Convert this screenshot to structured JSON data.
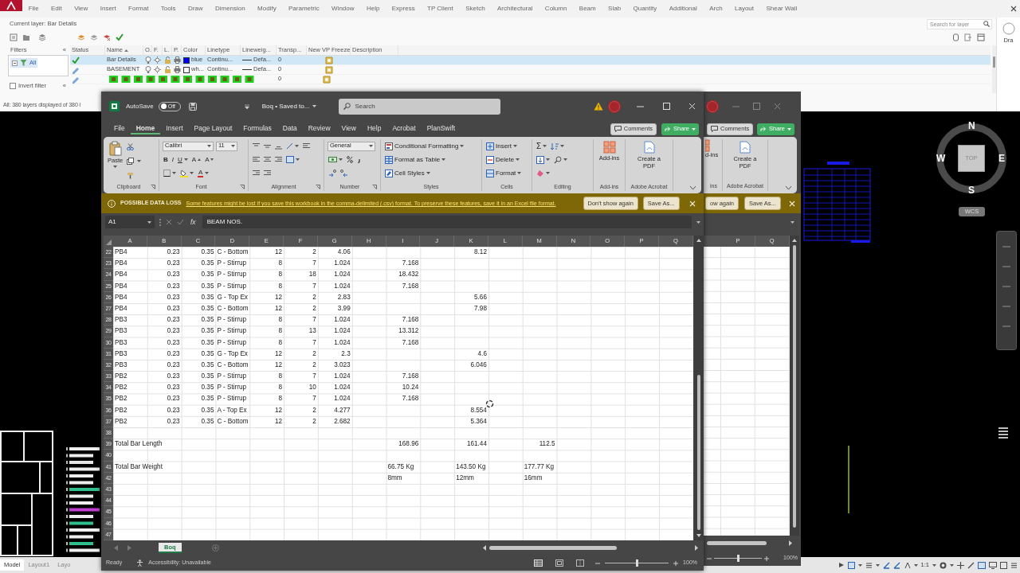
{
  "autocad": {
    "menu": [
      "File",
      "Edit",
      "View",
      "Insert",
      "Format",
      "Tools",
      "Draw",
      "Dimension",
      "Modify",
      "Parametric",
      "Window",
      "Help",
      "Express",
      "TP Client",
      "Sketch",
      "Architectural",
      "Column",
      "Beam",
      "Slab",
      "Quantity",
      "Additional",
      "Arch",
      "Layout",
      "Shear Wall"
    ],
    "layer_manager": {
      "current_layer": "Current layer: Bar Details",
      "search": {
        "placeholder": "Search for layer"
      },
      "filters": {
        "heading": "Filters",
        "collapse": "«",
        "items": [
          {
            "label": "All",
            "selected": true
          }
        ],
        "invert_filter": {
          "label": "Invert filter",
          "checked": false,
          "collapse": "«"
        }
      },
      "columns": [
        "Status",
        "Name",
        "O.",
        "F.",
        "L.",
        "P.",
        "Color",
        "Linetype",
        "Lineweig...",
        "Transp...",
        "New VP Freeze",
        "Description"
      ],
      "layers": [
        {
          "current": true,
          "selected": true,
          "covered": false,
          "name": "Bar Details",
          "color": "#0000ff",
          "color_label": "blue",
          "linetype": "Continu...",
          "lineweight": "Defa...",
          "transparency": "0"
        },
        {
          "current": false,
          "selected": false,
          "covered": false,
          "name": "BASEMENT",
          "color": "#ffffff",
          "color_label": "wh...",
          "linetype": "Continu...",
          "lineweight": "Defa...",
          "transparency": "0"
        },
        {
          "current": false,
          "selected": false,
          "covered": true,
          "transparency": "0"
        }
      ],
      "summary": "All: 380 layers displayed of 380 l"
    },
    "palette": {
      "label": "Dra"
    },
    "compass": {
      "north": "N",
      "west": "W",
      "east": "E",
      "south": "S",
      "view": "TOP",
      "ucs": "WCS"
    },
    "layout_tabs": [
      {
        "label": "Model",
        "selected": true
      },
      {
        "label": "Layout1",
        "selected": false
      },
      {
        "label": "Layo",
        "selected": false
      }
    ],
    "scale": "1:1"
  },
  "excel": {
    "title_bar": {
      "autosave": {
        "label": "AutoSave",
        "state_label": "Off",
        "on": false
      },
      "document": "Boq • Saved to...",
      "search": {
        "placeholder": "Search"
      }
    },
    "tabs": [
      {
        "label": "File",
        "selected": false
      },
      {
        "label": "Home",
        "selected": true
      },
      {
        "label": "Insert",
        "selected": false
      },
      {
        "label": "Page Layout",
        "selected": false
      },
      {
        "label": "Formulas",
        "selected": false
      },
      {
        "label": "Data",
        "selected": false
      },
      {
        "label": "Review",
        "selected": false
      },
      {
        "label": "View",
        "selected": false
      },
      {
        "label": "Help",
        "selected": false
      },
      {
        "label": "Acrobat",
        "selected": false
      },
      {
        "label": "PlanSwift",
        "selected": false
      }
    ],
    "comments": "Comments",
    "share": "Share",
    "ribbon": {
      "clipboard": {
        "paste": "Paste",
        "label": "Clipboard"
      },
      "font": {
        "name": "Calibri",
        "size": "11",
        "bold": "B",
        "italic": "I",
        "underline": "U",
        "grow": "A",
        "shrink": "A",
        "font_color": "A",
        "label": "Font"
      },
      "alignment": {
        "label": "Alignment"
      },
      "number": {
        "format": "General",
        "label": "Number"
      },
      "styles": {
        "items": [
          "Conditional Formatting",
          "Format as Table",
          "Cell Styles"
        ],
        "label": "Styles"
      },
      "cells": {
        "items": [
          "Insert",
          "Delete",
          "Format"
        ],
        "label": "Cells"
      },
      "editing": {
        "autosum": "Σ",
        "label": "Editing"
      },
      "addins": {
        "button": "Add-ins",
        "label": "Add-ins"
      },
      "acrobat": {
        "button": "Create a PDF",
        "label": "Adobe Acrobat"
      }
    },
    "message_bar": {
      "title": "POSSIBLE DATA LOSS",
      "message": "Some features might be lost if you save this workbook in the comma-delimited (.csv) format. To preserve these features, save it in an Excel file format.",
      "buttons": [
        "Don't show again",
        "Save As..."
      ]
    },
    "formula_bar": {
      "name_box": "A1",
      "fx": "fx",
      "content": "BEAM NOS."
    },
    "sheet": {
      "columns": [
        "A",
        "B",
        "C",
        "D",
        "E",
        "F",
        "G",
        "H",
        "I",
        "J",
        "K",
        "L",
        "M",
        "N",
        "O",
        "P",
        "Q"
      ],
      "rows": [
        {
          "number": "22",
          "cells": [
            "PB4",
            "0.23",
            "0.35",
            "C - Bottom",
            "12",
            "2",
            "4.06",
            null,
            null,
            null,
            "8.12"
          ]
        },
        {
          "number": "23",
          "cells": [
            "PB4",
            "0.23",
            "0.35",
            "P - Stirrup",
            "8",
            "7",
            "1.024",
            null,
            "7.168"
          ]
        },
        {
          "number": "24",
          "cells": [
            "PB4",
            "0.23",
            "0.35",
            "P - Stirrup",
            "8",
            "18",
            "1.024",
            null,
            "18.432"
          ]
        },
        {
          "number": "25",
          "cells": [
            "PB4",
            "0.23",
            "0.35",
            "P - Stirrup",
            "8",
            "7",
            "1.024",
            null,
            "7.168"
          ]
        },
        {
          "number": "26",
          "cells": [
            "PB4",
            "0.23",
            "0.35",
            "G - Top Ex",
            "12",
            "2",
            "2.83",
            null,
            null,
            null,
            "5.66"
          ]
        },
        {
          "number": "27",
          "cells": [
            "PB4",
            "0.23",
            "0.35",
            "C - Bottom",
            "12",
            "2",
            "3.99",
            null,
            null,
            null,
            "7.98"
          ]
        },
        {
          "number": "28",
          "cells": [
            "PB3",
            "0.23",
            "0.35",
            "P - Stirrup",
            "8",
            "7",
            "1.024",
            null,
            "7.168"
          ]
        },
        {
          "number": "29",
          "cells": [
            "PB3",
            "0.23",
            "0.35",
            "P - Stirrup",
            "8",
            "13",
            "1.024",
            null,
            "13.312"
          ]
        },
        {
          "number": "30",
          "cells": [
            "PB3",
            "0.23",
            "0.35",
            "P - Stirrup",
            "8",
            "7",
            "1.024",
            null,
            "7.168"
          ]
        },
        {
          "number": "31",
          "cells": [
            "PB3",
            "0.23",
            "0.35",
            "G - Top Ex",
            "12",
            "2",
            "2.3",
            null,
            null,
            null,
            "4.6"
          ]
        },
        {
          "number": "32",
          "cells": [
            "PB3",
            "0.23",
            "0.35",
            "C - Bottom",
            "12",
            "2",
            "3.023",
            null,
            null,
            null,
            "6.046"
          ]
        },
        {
          "number": "33",
          "cells": [
            "PB2",
            "0.23",
            "0.35",
            "P - Stirrup",
            "8",
            "7",
            "1.024",
            null,
            "7.168"
          ]
        },
        {
          "number": "34",
          "cells": [
            "PB2",
            "0.23",
            "0.35",
            "P - Stirrup",
            "8",
            "10",
            "1.024",
            null,
            "10.24"
          ]
        },
        {
          "number": "35",
          "cells": [
            "PB2",
            "0.23",
            "0.35",
            "P - Stirrup",
            "8",
            "7",
            "1.024",
            null,
            "7.168"
          ]
        },
        {
          "number": "36",
          "cells": [
            "PB2",
            "0.23",
            "0.35",
            "A - Top Ex",
            "12",
            "2",
            "4.277",
            null,
            null,
            null,
            "8.554"
          ]
        },
        {
          "number": "37",
          "cells": [
            "PB2",
            "0.23",
            "0.35",
            "C - Bottom",
            "12",
            "2",
            "2.682",
            null,
            null,
            null,
            "5.364"
          ]
        },
        {
          "number": "38"
        },
        {
          "number": "39",
          "cells": [
            "Total Bar Length",
            null,
            null,
            null,
            null,
            null,
            null,
            null,
            "168.96",
            null,
            "161.44",
            null,
            "112.5"
          ]
        },
        {
          "number": "40"
        },
        {
          "number": "41",
          "cells": [
            "Total Bar Weight",
            null,
            null,
            null,
            null,
            null,
            null,
            null,
            "66.75 Kg",
            null,
            "143.50 Kg",
            null,
            "177.77 Kg"
          ]
        },
        {
          "number": "42",
          "cells": [
            null,
            null,
            null,
            null,
            null,
            null,
            null,
            null,
            "8mm",
            null,
            "12mm",
            null,
            "16mm"
          ]
        },
        {
          "number": "43"
        },
        {
          "number": "44"
        },
        {
          "number": "45"
        },
        {
          "number": "46"
        },
        {
          "number": "47"
        }
      ]
    },
    "sheet_tabs": [
      {
        "label": "Boq",
        "selected": true
      }
    ],
    "status": {
      "ready": "Ready",
      "accessibility": "Accessibility: Unavailable",
      "zoom": {
        "level": 0.5,
        "reading": "100%"
      }
    }
  },
  "excel_back": {
    "comments": "Comments",
    "share": "Share",
    "addins": {
      "button": "d-ins",
      "label": "ins"
    },
    "acrobat": {
      "button": "Create a PDF",
      "label": "Adobe Acrobat"
    },
    "buttons": [
      "ow again",
      "Save As..."
    ],
    "columns": [
      "P",
      "Q"
    ],
    "zoom": {
      "level": 0.5,
      "reading": "100%"
    }
  }
}
